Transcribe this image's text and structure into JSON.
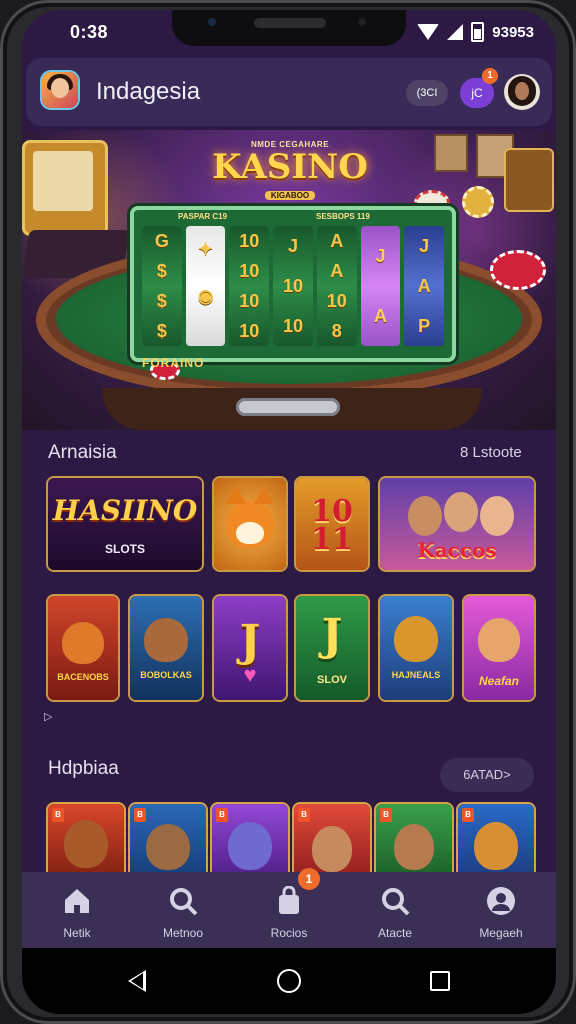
{
  "status_bar": {
    "time": "0:38",
    "battery_text": "93953"
  },
  "header": {
    "title": "Indagesia",
    "coins_label": "(3CI",
    "jc_label": "jC",
    "notification_count": "1"
  },
  "banner": {
    "logo_top": "NMDE CEGAHARE",
    "logo_main": "KASINO",
    "logo_sub": "KIGABOO",
    "reel_head_left": "PASPAR C19",
    "reel_head_right": "SESBOPS 119",
    "reel_footer": "FORAINO",
    "reels": [
      [
        "G",
        "$",
        "$",
        "$",
        "$"
      ],
      [
        "✦",
        "◉",
        "",
        ""
      ],
      [
        "10",
        "10",
        "10",
        "10"
      ],
      [
        "J",
        "10",
        "10",
        ""
      ],
      [
        "A",
        "A",
        "10",
        "8"
      ],
      [
        "J",
        "A",
        "",
        ""
      ],
      [
        "J",
        "A",
        "P",
        ""
      ]
    ]
  },
  "section1": {
    "title": "Arnaisia",
    "link": "8 Lstoote",
    "row1": [
      {
        "main": "HASIINO",
        "sub": "SLOTS"
      },
      {
        "main": ""
      },
      {
        "main": "10 11"
      },
      {
        "main": "Kaccos"
      }
    ],
    "row2": [
      {
        "main": "BACENOBS"
      },
      {
        "main": "BOBOLKAS"
      },
      {
        "main": "J"
      },
      {
        "main": "SLOV"
      },
      {
        "main": "HAJNEALS"
      },
      {
        "main": "Neafan"
      }
    ]
  },
  "section2": {
    "title": "Hdpbiaa",
    "pill": "6ATAD>"
  },
  "tabs": [
    {
      "label": "Netik",
      "icon": "home-icon"
    },
    {
      "label": "Metnoo",
      "icon": "search-icon"
    },
    {
      "label": "Rocios",
      "icon": "bag-icon",
      "badge": "1"
    },
    {
      "label": "Atacte",
      "icon": "search-icon"
    },
    {
      "label": "Megaeh",
      "icon": "user-icon"
    }
  ],
  "colors": {
    "background": "#2c1a45",
    "header": "#3a2a58",
    "tabbar": "#3b2f55",
    "accent": "#7c3fd6",
    "badge": "#f06a2a"
  }
}
